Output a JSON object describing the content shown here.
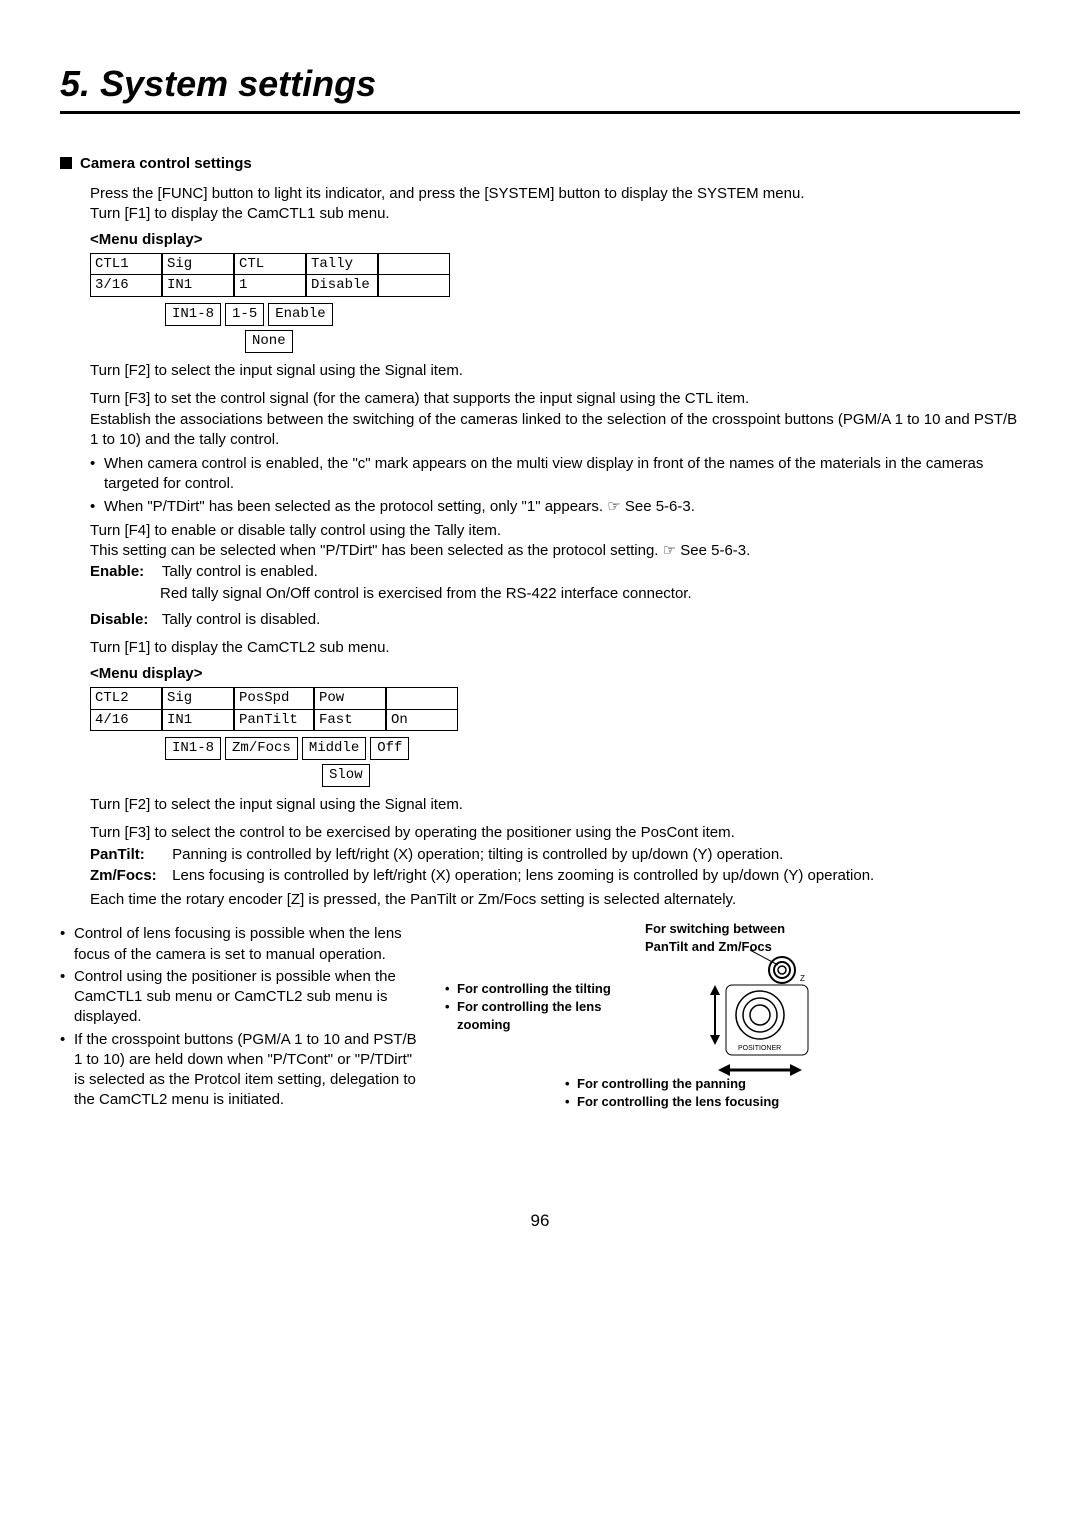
{
  "chapter_title": "5. System settings",
  "section_heading": "Camera control settings",
  "intro": {
    "p1": "Press the [FUNC] button to light its indicator, and press the [SYSTEM] button to display the SYSTEM menu.",
    "p2": "Turn [F1] to display the CamCTL1 sub menu."
  },
  "menu_display_label": "<Menu display>",
  "menu1": {
    "row1": {
      "c1": "CTL1",
      "c2": "Sig",
      "c3": "CTL",
      "c4": "Tally",
      "c5": "",
      "c6": ""
    },
    "row2": {
      "c1": "3/16",
      "c2": "IN1",
      "c3": "1",
      "c4": "Disable",
      "c5": "",
      "c6": ""
    },
    "opts": [
      "IN1-8",
      "1-5",
      "Enable"
    ],
    "opts2": [
      "None"
    ]
  },
  "body1": {
    "p1": "Turn [F2] to select the input signal using the Signal item.",
    "p2": "Turn [F3] to set the control signal (for the camera) that supports the input signal using the CTL item.",
    "p3": "Establish the associations between the switching of the cameras linked to the selection of the crosspoint buttons (PGM/A 1 to 10 and PST/B 1 to 10) and the tally control.",
    "b1": "When camera control is enabled, the \"c\" mark appears on the multi view display in front of the names of the materials in the cameras targeted for control.",
    "b2_a": "When \"P/TDirt\" has been selected as the protocol setting, only \"1\" appears. ",
    "b2_b": "☞ See 5-6-3.",
    "p4": "Turn [F4] to enable or disable tally control using the Tally item.",
    "p5_a": "This setting can be selected when \"P/TDirt\" has been selected as the protocol setting. ",
    "p5_b": "☞ See 5-6-3.",
    "enable_lbl": "Enable:",
    "enable_txt1": "Tally control is enabled.",
    "enable_txt2": "Red tally signal On/Off control is exercised from the RS-422 interface connector.",
    "disable_lbl": "Disable:",
    "disable_txt": "Tally control is disabled.",
    "p6": "Turn [F1] to display the CamCTL2 sub menu."
  },
  "menu2": {
    "row1": {
      "c1": "CTL2",
      "c2": "Sig",
      "c3": "PosSpd",
      "c4": "Pow",
      "c5": "",
      "c6": ""
    },
    "row2": {
      "c1": "4/16",
      "c2": "IN1",
      "c3": "PanTilt",
      "c4": "Fast",
      "c5": "On",
      "c6": ""
    },
    "opts": [
      "IN1-8",
      "Zm/Focs",
      "Middle",
      "Off"
    ],
    "opts2": [
      "Slow"
    ]
  },
  "body2": {
    "p1": "Turn [F2] to select the input signal using the Signal item.",
    "p2": "Turn [F3] to select the control to be exercised by operating the positioner using the PosCont item.",
    "pt_lbl": "PanTilt:",
    "pt_txt": "Panning is controlled by left/right (X) operation; tilting is controlled by up/down (Y) operation.",
    "zf_lbl": "Zm/Focs:",
    "zf_txt": "Lens focusing is controlled by left/right (X) operation; lens zooming is controlled by up/down (Y) operation.",
    "p3": "Each time the rotary encoder [Z] is pressed, the PanTilt or Zm/Focs setting is selected alternately."
  },
  "colL": {
    "b1": "Control of lens focusing is possible when the lens focus of the camera is set to manual operation.",
    "b2": "Control using the positioner is possible when the CamCTL1 sub menu or CamCTL2 sub menu is displayed.",
    "b3": "If the crosspoint buttons (PGM/A 1 to 10 and PST/B 1 to 10) are held down when \"P/TCont\" or \"P/TDirt\" is selected as the Protcol item setting, delegation to the CamCTL2 menu is initiated."
  },
  "colR": {
    "switch_lbl1": "For switching between",
    "switch_lbl2": "PanTilt and Zm/Focs",
    "tilt_b1": "For controlling the tilting",
    "tilt_b2": "For controlling the lens zooming",
    "pan_b1": "For controlling the panning",
    "pan_b2": "For controlling the lens focusing",
    "pos_label": "POSITIONER",
    "z_label": "Z"
  },
  "page_number": "96"
}
